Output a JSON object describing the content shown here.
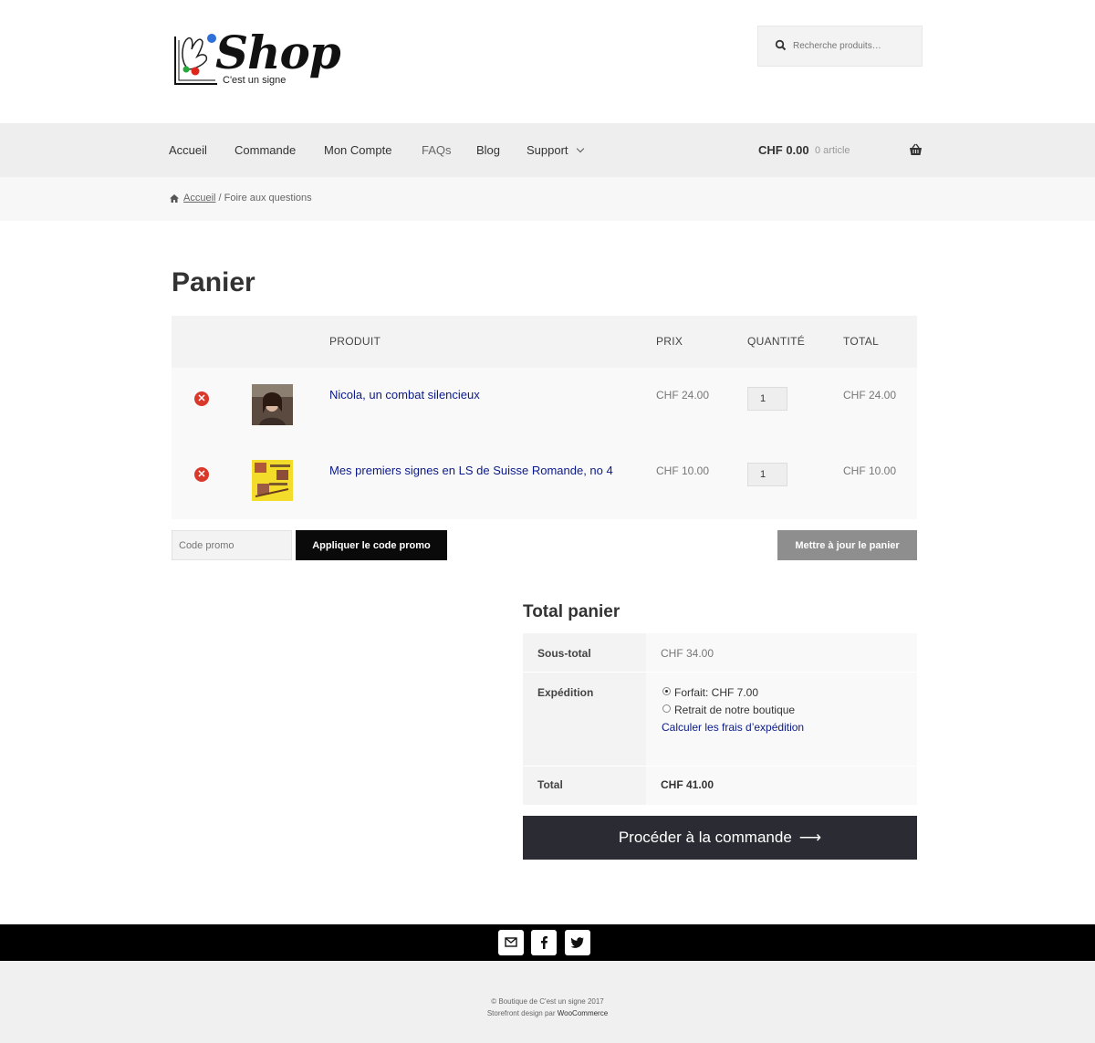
{
  "header": {
    "logo_word": "Shop",
    "logo_tagline": "C'est un signe",
    "search_placeholder": "Recherche produits…"
  },
  "nav": {
    "items": [
      "Accueil",
      "Commande",
      "Mon Compte",
      "FAQs",
      "Blog",
      "Support"
    ],
    "cart_amount": "CHF 0.00",
    "cart_count": "0 article"
  },
  "breadcrumb": {
    "home": "Accueil",
    "separator": " / ",
    "current": "Foire aux questions"
  },
  "page_title": "Panier",
  "cart": {
    "headers": {
      "product": "PRODUIT",
      "price": "PRIX",
      "quantity": "QUANTITÉ",
      "total": "TOTAL"
    },
    "items": [
      {
        "name": "Nicola, un combat silencieux",
        "price": "CHF 24.00",
        "qty": "1",
        "total": "CHF 24.00"
      },
      {
        "name": "Mes premiers signes en LS de Suisse Romande, no 4",
        "price": "CHF 10.00",
        "qty": "1",
        "total": "CHF 10.00"
      }
    ],
    "coupon_placeholder": "Code promo",
    "apply_coupon_label": "Appliquer le code promo",
    "update_cart_label": "Mettre à jour le panier"
  },
  "totals": {
    "title": "Total panier",
    "subtotal_label": "Sous-total",
    "subtotal_value": "CHF 34.00",
    "shipping_label": "Expédition",
    "shipping_option_1": "Forfait: CHF 7.00",
    "shipping_option_2": "Retrait de notre boutique",
    "calc_shipping_link": "Calculer les frais d’expédition",
    "total_label": "Total",
    "total_value": "CHF 41.00",
    "checkout_label": "Procéder à la commande"
  },
  "footer": {
    "social_icons": [
      "mail-icon",
      "facebook-icon",
      "twitter-icon"
    ],
    "copyright": "© Boutique de C'est un signe 2017",
    "credit_prefix": "Storefront design par ",
    "credit_link": "WooCommerce"
  },
  "colors": {
    "link_blue": "#0b1a8a",
    "remove_red": "#d9392b",
    "checkout_bg": "#2b2b33"
  }
}
